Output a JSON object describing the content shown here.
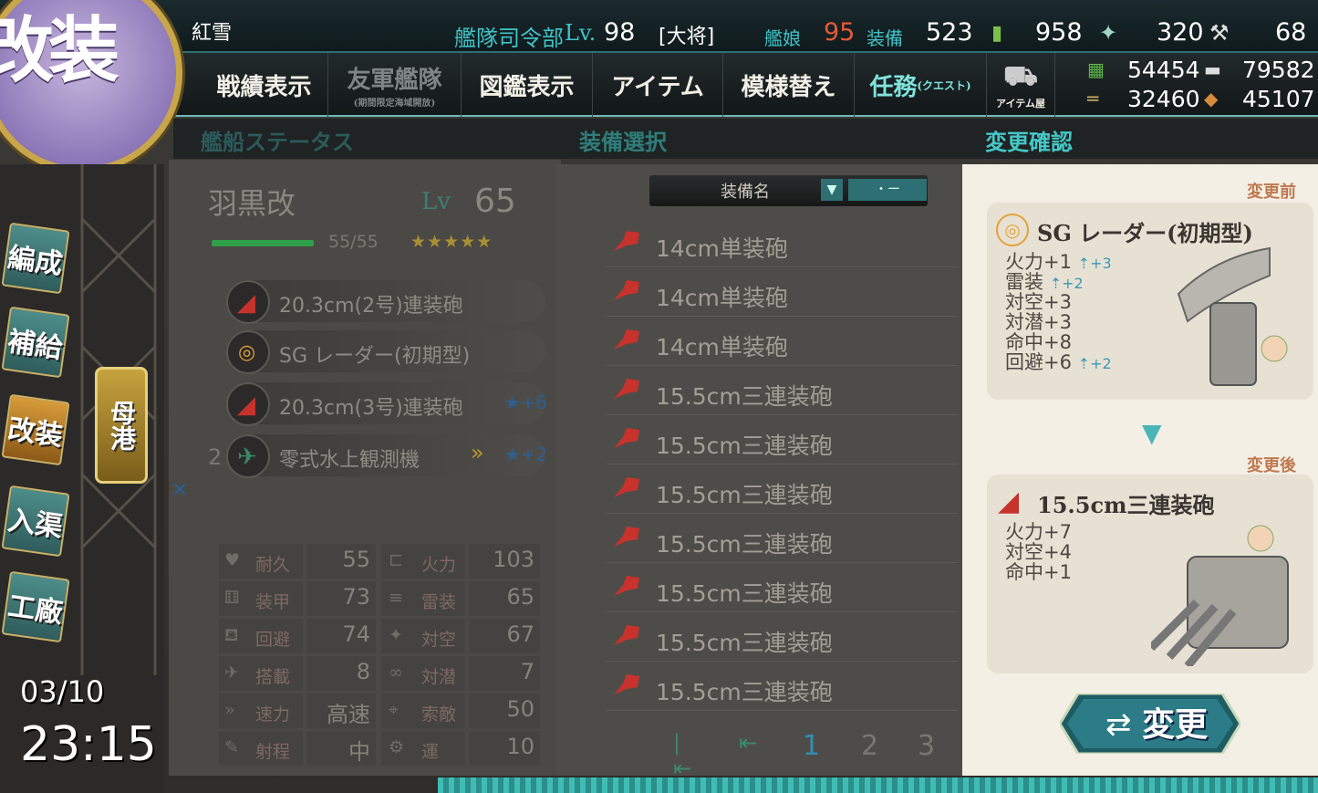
{
  "header": {
    "admiral_name": "紅雪",
    "hq_label": "艦隊司令部",
    "hq_level_prefix": "Lv.",
    "hq_level": "98",
    "rank": "[大将]",
    "ship_label": "艦娘",
    "ship_count": "95",
    "equip_label": "装備",
    "equip_count": "523",
    "bucket": "958",
    "dev_material": "320",
    "improve_material": "68",
    "fuel": "54454",
    "ammo": "79582",
    "steel": "32460",
    "bauxite": "45107"
  },
  "menu": {
    "items": [
      {
        "label": "戦績表示"
      },
      {
        "label": "友軍艦隊",
        "sub": "(期間限定海域開放)"
      },
      {
        "label": "図鑑表示"
      },
      {
        "label": "アイテム"
      },
      {
        "label": "模様替え"
      },
      {
        "label": "任務",
        "sub": "(クエスト)"
      }
    ],
    "item_shop_label": "アイテム屋"
  },
  "badge": {
    "label": "改装"
  },
  "sections": {
    "ship_status": "艦船ステータス",
    "equip_select": "装備選択",
    "change_confirm": "変更確認"
  },
  "sidebar": {
    "items": [
      {
        "label": "編成"
      },
      {
        "label": "補給"
      },
      {
        "label": "改装"
      },
      {
        "label": "入渠"
      },
      {
        "label": "工廠"
      }
    ],
    "port_label": "母港",
    "date": "03/10",
    "time": "23:15"
  },
  "ship": {
    "name": "羽黒改",
    "lv_label": "Lv",
    "level": "65",
    "hp": "55/55",
    "stars": "★★★★★",
    "slots": [
      {
        "name": "20.3cm(2号)連装砲",
        "improve": "",
        "icon": "main-gun"
      },
      {
        "name": "SG レーダー(初期型)",
        "improve": "",
        "icon": "radar"
      },
      {
        "name": "20.3cm(3号)連装砲",
        "improve": "★+6",
        "icon": "main-gun"
      },
      {
        "name": "零式水上観測機",
        "improve": "★+2",
        "icon": "seaplane",
        "count": "2"
      }
    ],
    "stats": [
      {
        "l1": "耐久",
        "v1": "55",
        "l2": "火力",
        "v2": "103"
      },
      {
        "l1": "装甲",
        "v1": "73",
        "l2": "雷装",
        "v2": "65"
      },
      {
        "l1": "回避",
        "v1": "74",
        "l2": "対空",
        "v2": "67"
      },
      {
        "l1": "搭載",
        "v1": "8",
        "l2": "対潜",
        "v2": "7"
      },
      {
        "l1": "速力",
        "v1": "高速",
        "l2": "索敵",
        "v2": "50"
      },
      {
        "l1": "射程",
        "v1": "中",
        "l2": "運",
        "v2": "10"
      }
    ]
  },
  "equip_list": {
    "header_label": "装備名",
    "sort_label": "・ー",
    "items": [
      "14cm単装砲",
      "14cm単装砲",
      "14cm単装砲",
      "15.5cm三連装砲",
      "15.5cm三連装砲",
      "15.5cm三連装砲",
      "15.5cm三連装砲",
      "15.5cm三連装砲",
      "15.5cm三連装砲",
      "15.5cm三連装砲"
    ],
    "pages": [
      "1",
      "2",
      "3"
    ],
    "current_page": "1"
  },
  "confirm": {
    "before_label": "変更前",
    "after_label": "変更後",
    "before": {
      "name": "SG レーダー(初期型)",
      "stats": [
        {
          "text": "火力+1",
          "bonus": "+3"
        },
        {
          "text": "雷装",
          "bonus": "+2"
        },
        {
          "text": "対空+3",
          "bonus": ""
        },
        {
          "text": "対潜+3",
          "bonus": ""
        },
        {
          "text": "命中+8",
          "bonus": ""
        },
        {
          "text": "回避+6",
          "bonus": "+2"
        }
      ]
    },
    "after": {
      "name": "15.5cm三連装砲",
      "stats": [
        {
          "text": "火力+7"
        },
        {
          "text": "対空+4"
        },
        {
          "text": "命中+1"
        }
      ]
    },
    "change_button": "変更"
  },
  "colors": {
    "accent_teal": "#3fc3c7",
    "gun_red": "#c8322d",
    "improve_blue": "#2e5f90"
  }
}
